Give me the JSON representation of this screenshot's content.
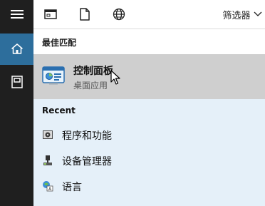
{
  "toolbar": {
    "filter_label": "筛选器"
  },
  "best_match": {
    "header": "最佳匹配",
    "title": "控制面板",
    "subtitle": "桌面应用"
  },
  "recent": {
    "header": "Recent",
    "items": [
      {
        "label": "程序和功能",
        "icon": "programs-features-icon"
      },
      {
        "label": "设备管理器",
        "icon": "device-manager-icon"
      },
      {
        "label": "语言",
        "icon": "language-icon"
      }
    ]
  },
  "colors": {
    "rail": "#1f1f1f",
    "rail_selected": "#2d6e9c",
    "best_highlight": "#cfcfcf",
    "recent_bg": "#e5f0f9"
  }
}
